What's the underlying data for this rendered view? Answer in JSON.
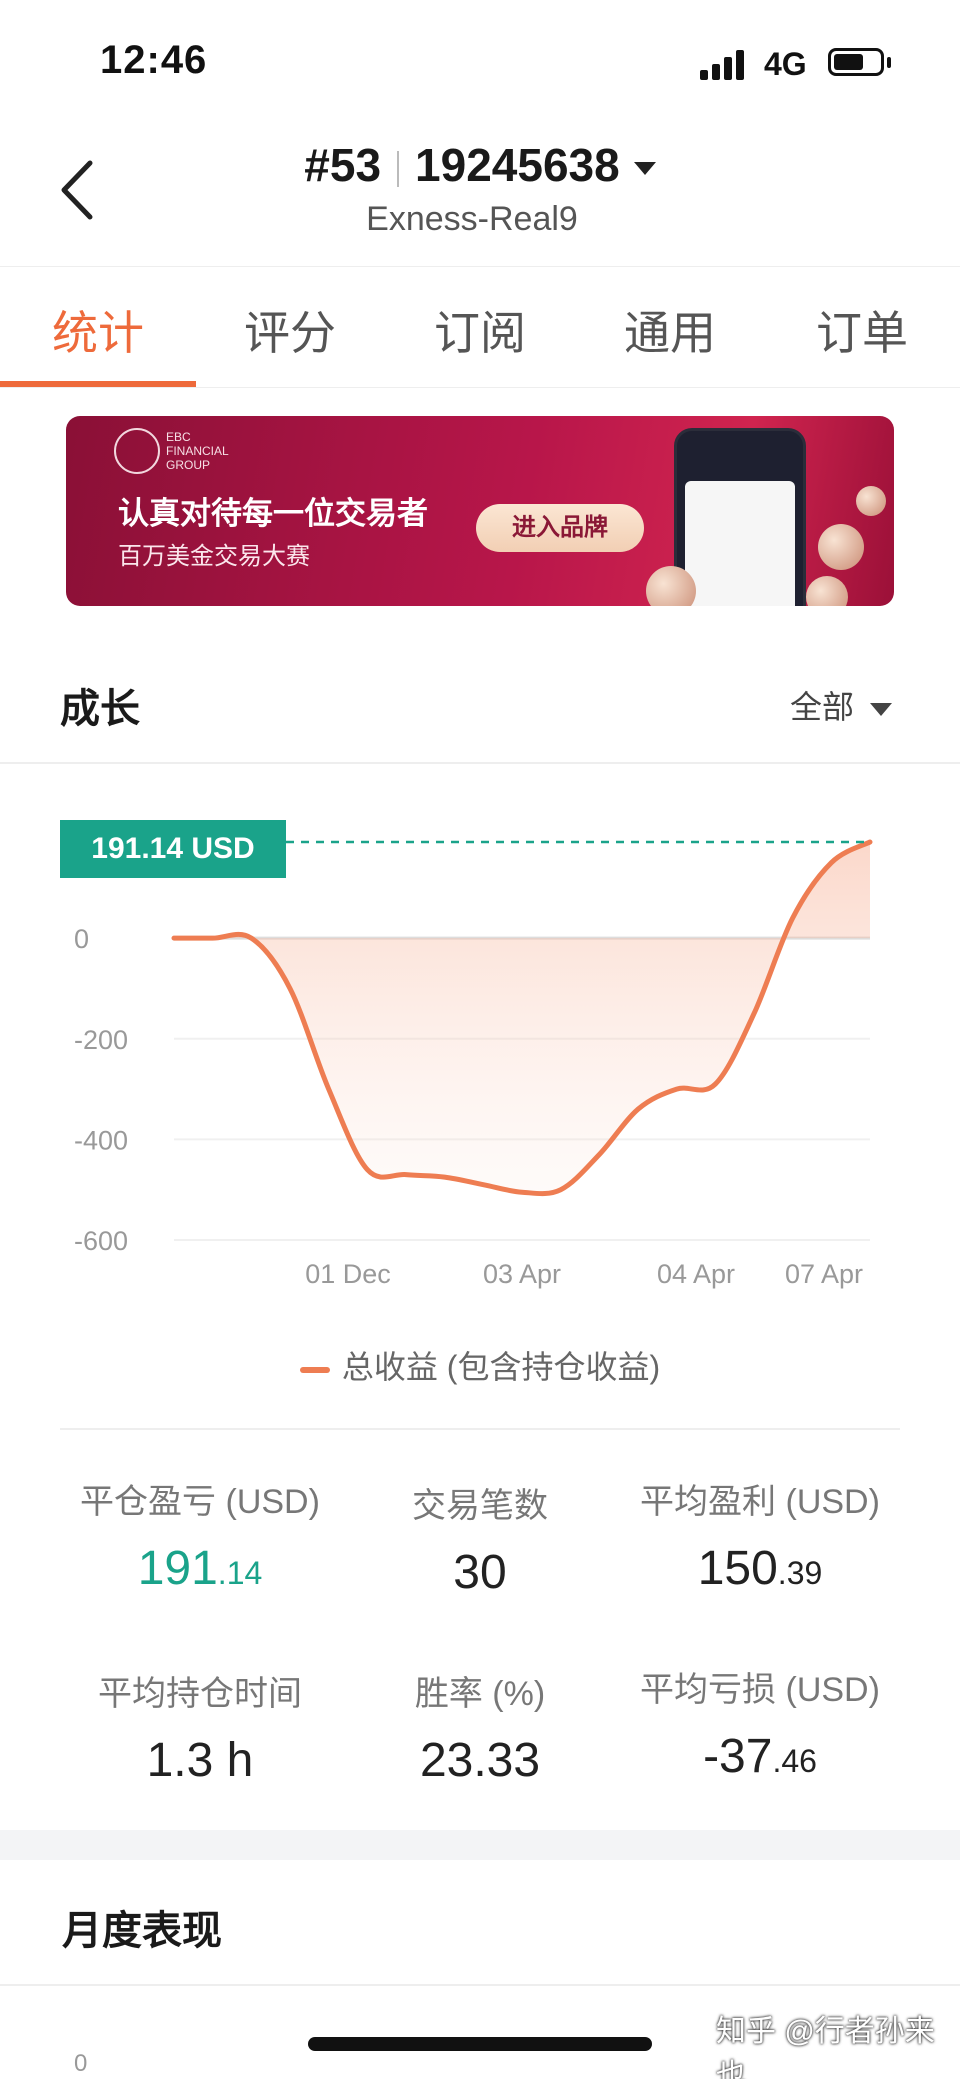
{
  "status_bar": {
    "time": "12:46",
    "network": "4G",
    "battery_level": 0.65
  },
  "header": {
    "rank": "#53",
    "account_number": "19245638",
    "server": "Exness-Real9"
  },
  "tabs": [
    {
      "label": "统计",
      "active": true
    },
    {
      "label": "评分",
      "active": false
    },
    {
      "label": "订阅",
      "active": false
    },
    {
      "label": "通用",
      "active": false
    },
    {
      "label": "订单",
      "active": false
    }
  ],
  "banner": {
    "logo_text": "EBC FINANCIAL GROUP",
    "title": "认真对待每一位交易者",
    "subtitle": "百万美金交易大赛",
    "button_label": "进入品牌"
  },
  "growth": {
    "title": "成长",
    "filter_label": "全部"
  },
  "chart_data": {
    "type": "area",
    "current_value_label": "191.14 USD",
    "current_value": 191.14,
    "y_ticks": [
      "0",
      "-200",
      "-400",
      "-600"
    ],
    "ylim": [
      -600,
      191.14
    ],
    "x_ticks": [
      "01 Dec",
      "03 Apr",
      "04 Apr",
      "07 Apr"
    ],
    "series": [
      {
        "name": "总收益 (包含持仓收益)",
        "values": [
          0,
          0,
          0,
          -100,
          -300,
          -460,
          -470,
          -475,
          -490,
          -505,
          -500,
          -430,
          -340,
          -300,
          -290,
          -150,
          40,
          150,
          191.14
        ]
      }
    ],
    "colors": {
      "line": "#ee7d52",
      "label_bg": "#1aa38a",
      "dashed_line": "#1aa38a"
    },
    "legend": "总收益 (包含持仓收益)"
  },
  "stats": {
    "closed_pnl": {
      "label": "平仓盈亏 (USD)",
      "int": "191",
      "dec": ".14"
    },
    "trade_count": {
      "label": "交易笔数",
      "value": "30"
    },
    "avg_profit": {
      "label": "平均盈利 (USD)",
      "int": "150",
      "dec": ".39"
    },
    "avg_hold_time": {
      "label": "平均持仓时间",
      "value": "1.3 h"
    },
    "win_rate": {
      "label": "胜率 (%)",
      "value": "23.33"
    },
    "avg_loss": {
      "label": "平均亏损 (USD)",
      "int": "-37",
      "dec": ".46"
    }
  },
  "monthly": {
    "title": "月度表现",
    "first_tick": "0"
  },
  "watermark": "知乎 @行者孙来也"
}
